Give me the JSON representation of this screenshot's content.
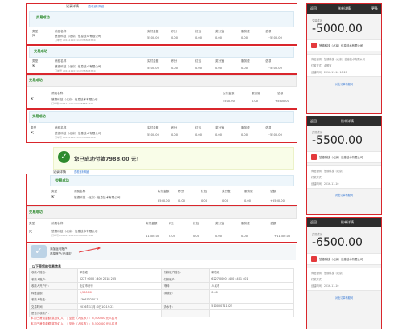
{
  "panels": {
    "top_heading": "记录详情",
    "top_link": "查看返利明细",
    "status": "交易成功",
    "col": {
      "type": "类型",
      "name": "消费名称",
      "paid": "实付金额",
      "points": "积分",
      "redpack": "红包",
      "reward": "奖分宝",
      "service": "服务费",
      "total": "总额"
    },
    "merchant": "慧德科技（北京）信息技术有限公司",
    "order_no": "订单号 2016111011103388883344",
    "row1": {
      "paid": "5500.00",
      "points": "0.00",
      "redpack": "0.00",
      "reward": "0.00",
      "service": "0.00",
      "total": "+5500.00"
    },
    "row2": {
      "paid": "5500.00",
      "points": "0.00",
      "redpack": "0.00",
      "reward": "0.00",
      "service": "0.00",
      "total": "+5500.00"
    },
    "row3": {
      "paid_label": "实付金额",
      "service_label": "服务费",
      "total_label": "总额",
      "paid": "5500.00",
      "service": "0.00",
      "total": "+5500.00"
    },
    "row4": {
      "paid": "5500.00",
      "points": "0.00",
      "redpack": "0.00",
      "reward": "0.00",
      "service": "0.00",
      "total": "+5500.00"
    },
    "row5": {
      "paid": "5500.00",
      "points": "0.00",
      "redpack": "0.00",
      "reward": "0.00",
      "service": "0.00",
      "total": "+5500.00"
    },
    "row6": {
      "paid": "11500.00",
      "points": "0.00",
      "redpack": "0.00",
      "reward": "0.00",
      "service": "0.00",
      "total": "+11500.00"
    },
    "success_banner": "您已成功付款7988.00 元！"
  },
  "upload": {
    "line1": "添加返利账户",
    "line2": "选择账户(已绑定)"
  },
  "detail": {
    "title": "以下是您的交易信息",
    "rows": [
      [
        "收款人姓名：",
        "郭志峰",
        "付款帐户姓名：",
        "郭志峰"
      ],
      [
        "收款人账户：",
        "6227 0000 1400 2018 235",
        "付款帐户：",
        "6227 0000 1400 4401 401"
      ],
      [
        "收款人开户行：",
        "北京市分行",
        "币种：",
        "人民币"
      ],
      [
        "转账金额：",
        "5,500.00",
        "手续费：",
        "0.00"
      ],
      [
        "收款人电话：",
        "13661327071",
        "",
        ""
      ],
      [
        "交易时间：",
        "2016年11月10日10:19:23",
        "流水号：",
        "510000711025"
      ],
      [
        "是否为收款户：",
        "",
        "",
        ""
      ]
    ],
    "footer1": "本次已消费金额  奖励汇入：  | 至此（人民币）：5,500.00 元人民币",
    "footer2": "本次已消费金额  奖励汇入：  | 至此（人民币）：5,500.00 元人民币"
  },
  "phones": [
    {
      "title": "账单详情",
      "back": "返回",
      "right": "更多",
      "amount": "-5000.00",
      "status": "交易成功",
      "merchant": "慧德科技（北京）信息技术有限公司",
      "r1k": "商品说明",
      "r1v": "慧德科技（北京）信息技术有限公司",
      "r2k": "付款方式",
      "r2v": "余额宝",
      "r3k": "创建时间",
      "r3v": "2016-11-10 10:20",
      "link": "对此订单有疑问"
    },
    {
      "title": "账单详情",
      "back": "返回",
      "right": "",
      "amount": "-5500.00",
      "status": "交易成功",
      "merchant": "慧德科技（北京）信息技术有限公司",
      "r1k": "商品说明",
      "r1v": "慧德科技（北京）",
      "r2k": "付款方式",
      "r2v": "",
      "r3k": "创建时间",
      "r3v": "2016-11-10",
      "link": "对此订单有疑问"
    },
    {
      "title": "账单详情",
      "back": "返回",
      "right": "",
      "amount": "-6500.00",
      "status": "交易成功",
      "merchant": "慧德科技（北京）信息技术有限公司",
      "r1k": "商品说明",
      "r1v": "慧德科技（北京）",
      "r2k": "付款方式",
      "r2v": "",
      "r3k": "创建时间",
      "r3v": "2016-11-10",
      "link": "对此订单有疑问"
    }
  ]
}
